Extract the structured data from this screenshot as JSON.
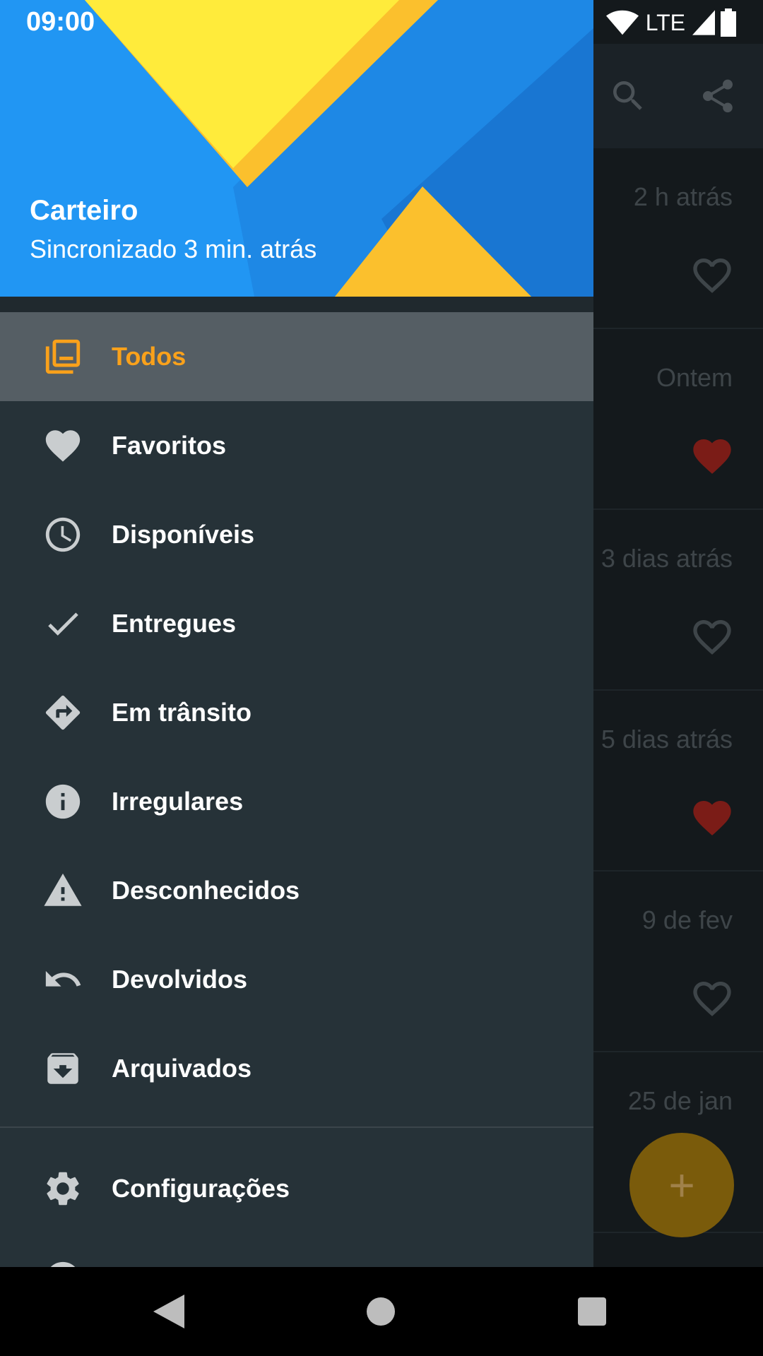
{
  "status_bar": {
    "time": "09:00",
    "network": "LTE"
  },
  "header": {
    "title": "Carteiro",
    "subtitle": "Sincronizado 3 min. atrás"
  },
  "menu": {
    "items": [
      {
        "label": "Todos",
        "icon": "package-stack-icon",
        "active": true
      },
      {
        "label": "Favoritos",
        "icon": "heart-icon"
      },
      {
        "label": "Disponíveis",
        "icon": "clock-icon"
      },
      {
        "label": "Entregues",
        "icon": "check-icon"
      },
      {
        "label": "Em trânsito",
        "icon": "directions-icon"
      },
      {
        "label": "Irregulares",
        "icon": "info-icon"
      },
      {
        "label": "Desconhecidos",
        "icon": "warning-icon"
      },
      {
        "label": "Devolvidos",
        "icon": "undo-icon"
      },
      {
        "label": "Arquivados",
        "icon": "archive-icon"
      }
    ],
    "settings": {
      "label": "Configurações",
      "icon": "gear-icon"
    }
  },
  "background_list": {
    "rows": [
      {
        "date": "2 h atrás",
        "favorite": false
      },
      {
        "date": "Ontem",
        "favorite": true
      },
      {
        "date": "3 dias atrás",
        "favorite": false
      },
      {
        "date": "5 dias atrás",
        "favorite": true
      },
      {
        "date": "9 de fev",
        "favorite": false
      },
      {
        "date": "25 de jan",
        "favorite": false
      }
    ],
    "fab_label": "+"
  },
  "colors": {
    "accent": "#f9a11b",
    "drawer_bg": "#263238",
    "favorite": "#7b1c17"
  }
}
